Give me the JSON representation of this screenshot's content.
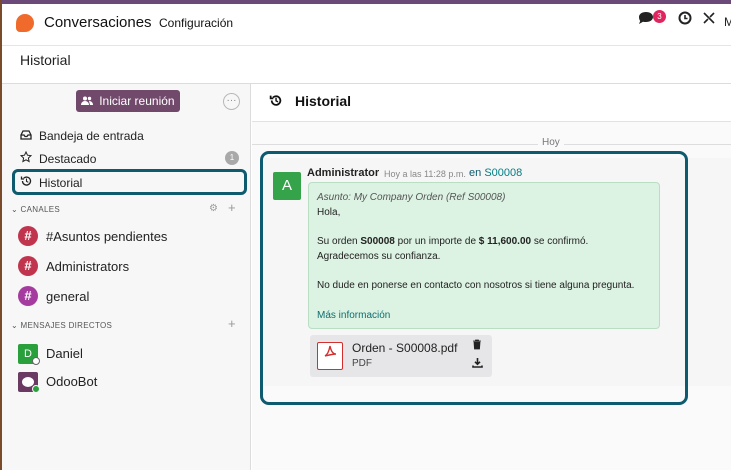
{
  "app": {
    "title": "Conversaciones",
    "menu_config": "Configuración"
  },
  "systray": {
    "messages_count": "3",
    "chat_icon": "chat-icon",
    "clock_icon": "clock-icon",
    "tools_icon": "tools-icon",
    "truncated_letter": "M"
  },
  "breadcrumb": {
    "title": "Historial"
  },
  "sidebar": {
    "meeting_label": "Iniciar reunión",
    "more_icon": "···",
    "items": [
      {
        "label": "Bandeja de entrada",
        "icon": "inbox-icon"
      },
      {
        "label": "Destacado",
        "icon": "star-icon",
        "count": "1"
      },
      {
        "label": "Historial",
        "icon": "history-icon"
      }
    ],
    "channels_header": "CANALES",
    "channels": [
      {
        "label": "#Asuntos pendientes",
        "color": "#c0344d"
      },
      {
        "label": "Administrators",
        "color": "#c0344d"
      },
      {
        "label": "general",
        "color": "#a53b9e"
      }
    ],
    "dm_header": "MENSAJES DIRECTOS",
    "direct_messages": [
      {
        "label": "Daniel",
        "avatar_letter": "D"
      },
      {
        "label": "OdooBot"
      }
    ]
  },
  "main": {
    "title": "Historial",
    "day_label": "Hoy",
    "message": {
      "avatar_letter": "A",
      "author": "Administrator",
      "time": "Hoy a las 11:28 p.m.",
      "ref_prefix": "en",
      "ref_link": "S00008",
      "subject": "Asunto: My Company Orden (Ref S00008)",
      "greeting": "Hola,",
      "line1_a": "Su orden ",
      "line1_b": "S00008",
      "line1_c": " por un importe de ",
      "line1_d": "$ 11,600.00",
      "line1_e": " se confirmó.",
      "line2": "Agradecemos su confianza.",
      "line3": "No dude en ponerse en contacto con nosotros si tiene alguna pregunta.",
      "more_link": "Más información"
    },
    "attachment": {
      "name": "Orden - S00008.pdf",
      "type": "PDF"
    }
  },
  "colors": {
    "accent": "#71496b",
    "highlight_border": "#0e5a6e",
    "bubble": "#dcf2e2",
    "link": "#017e84"
  }
}
